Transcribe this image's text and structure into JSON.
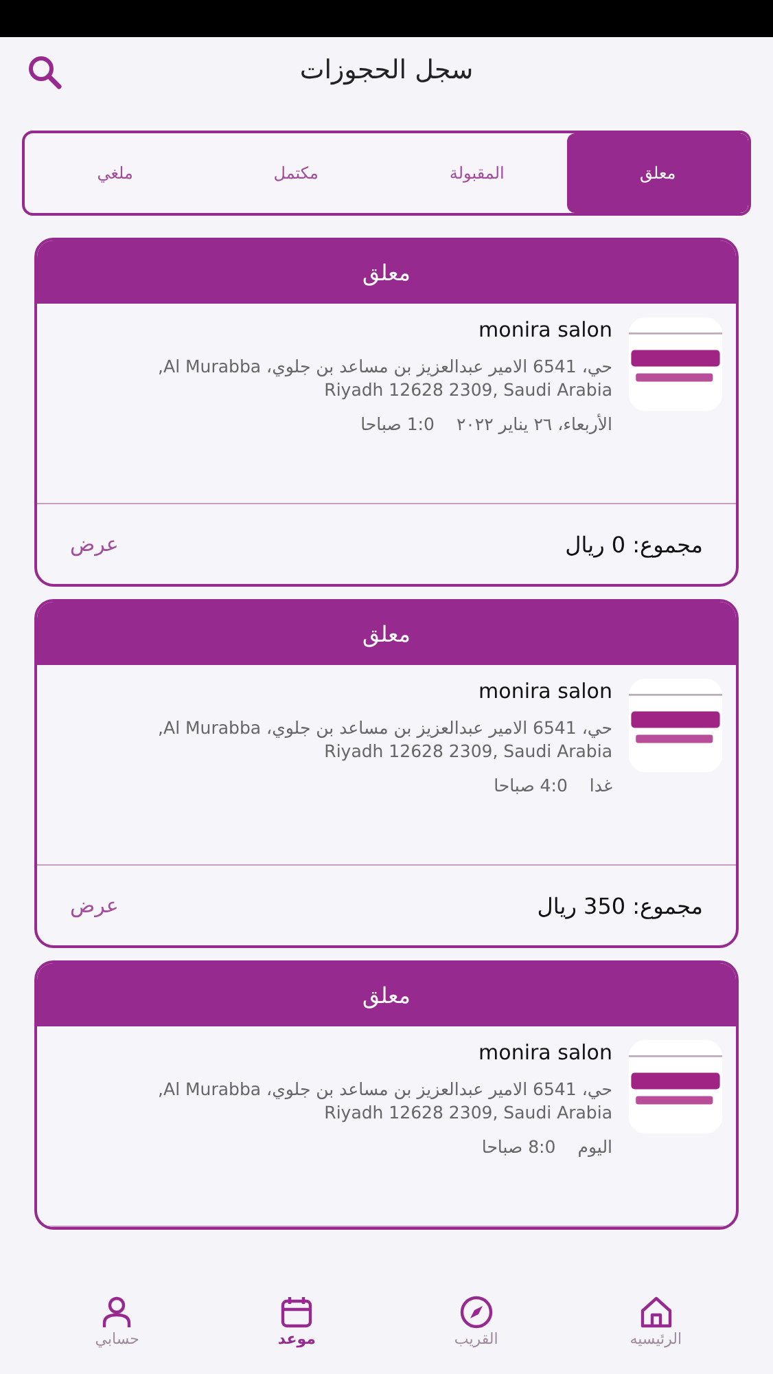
{
  "header": {
    "title": "سجل الحجوزات"
  },
  "tabs": [
    {
      "label": "معلق",
      "selected": true
    },
    {
      "label": "المقبولة",
      "selected": false
    },
    {
      "label": "مكتمل",
      "selected": false
    },
    {
      "label": "ملغي",
      "selected": false
    }
  ],
  "bookings": [
    {
      "status": "معلق",
      "logo": {
        "kind": "picture"
      },
      "salon": "monira salon",
      "address_lines": [
        "حي، 6541 الامير عبدالعزيز بن مساعد بن جلوي، Al Murabba,",
        "Riyadh 12628 2309, Saudi Arabia"
      ],
      "date": "الأربعاء، ٢٦ يناير ٢٠٢٢",
      "time": "1:0 صباحا",
      "total": "مجموع: 0 ريال",
      "view": "عرض"
    },
    {
      "status": "معلق",
      "logo": {
        "kind": "picture"
      },
      "salon": "monira salon",
      "address_lines": [
        "حي، 6541 الامير عبدالعزيز بن مساعد بن جلوي، Al Murabba,",
        "Riyadh 12628 2309, Saudi Arabia"
      ],
      "date": "غدا",
      "time": "4:0 صباحا",
      "total": "مجموع: 350 ريال",
      "view": "عرض"
    },
    {
      "status": "معلق",
      "logo": {
        "kind": "picture"
      },
      "salon": "monira salon",
      "address_lines": [
        "حي، 6541 الامير عبدالعزيز بن مساعد بن جلوي، Al Murabba,",
        "Riyadh 12628 2309, Saudi Arabia"
      ],
      "date": "اليوم",
      "time": "8:0 صباحا"
    }
  ],
  "bottom_nav": [
    {
      "label": "الرئيسيه",
      "kind": "home",
      "selected": false
    },
    {
      "label": "القريب",
      "kind": "compass",
      "selected": false
    },
    {
      "label": "موعد",
      "kind": "calendar",
      "selected": true
    },
    {
      "label": "حسابي",
      "kind": "person",
      "selected": false
    }
  ]
}
